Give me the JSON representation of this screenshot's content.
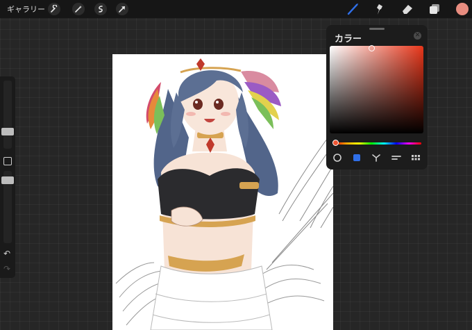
{
  "toolbar": {
    "gallery_label": "ギャラリー",
    "left_tools": [
      "wrench-icon",
      "magic-wand-icon",
      "selection-icon",
      "transform-arrow-icon"
    ],
    "right_tools": [
      "brush-icon",
      "smudge-icon",
      "eraser-icon",
      "layers-icon"
    ],
    "current_color": "#e88d80",
    "active_tool_color": "#2f6fe8"
  },
  "sidebar": {
    "brush_size": 0.75,
    "opacity": 0.2
  },
  "color_panel": {
    "title": "カラー",
    "selected_hue": "#e8361a",
    "modes": [
      "disc",
      "classic",
      "harmony",
      "value",
      "palettes"
    ],
    "active_mode": "classic"
  },
  "artwork": {
    "skin": "#f7e3d6",
    "hair": "#5c6f93",
    "top": "#2b2b2e",
    "gold": "#d6a351",
    "feather_colors": [
      "#d34b6b",
      "#e68a3a",
      "#e3d14d",
      "#7bbf5a",
      "#5a7fd0",
      "#9b5bc4"
    ]
  }
}
